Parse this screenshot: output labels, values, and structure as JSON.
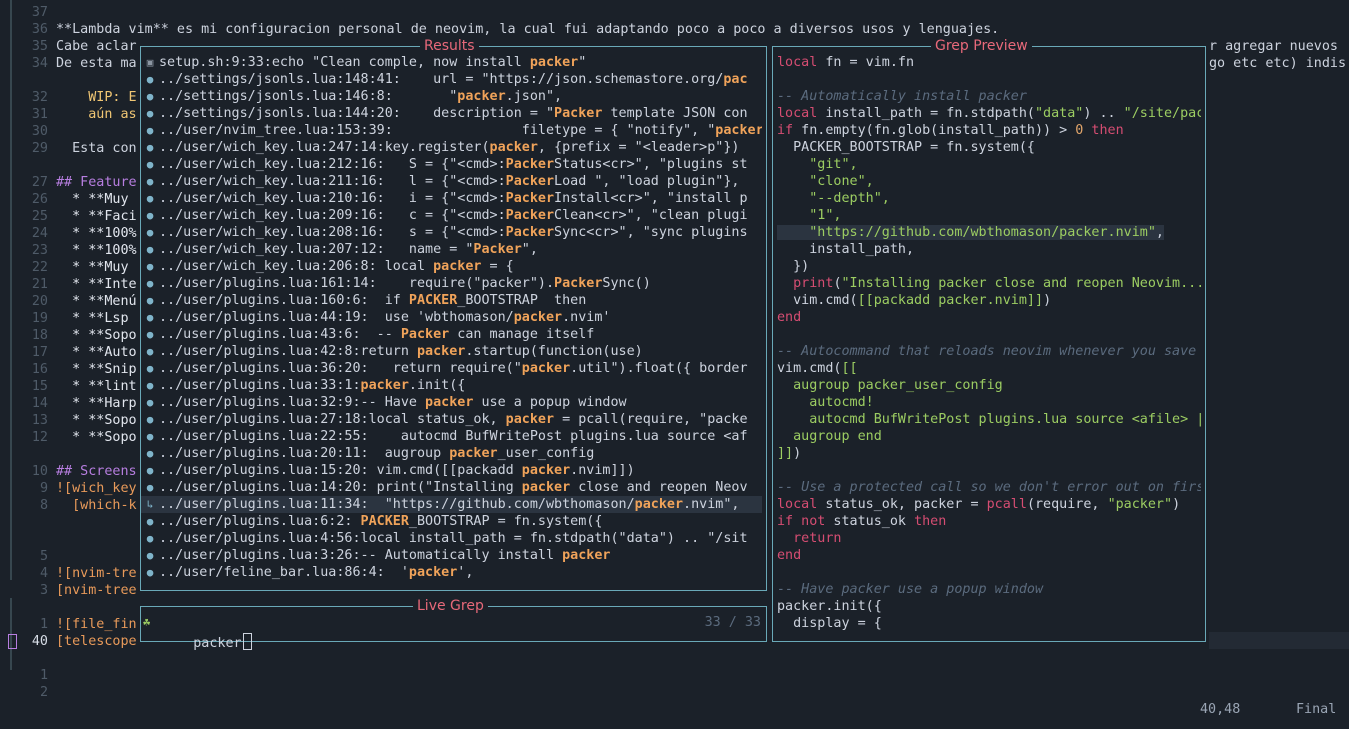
{
  "editor": {
    "line_numbers": [
      "37",
      "36",
      "35",
      "34",
      "",
      "32",
      "31",
      "30",
      "29",
      "",
      "27",
      "26",
      "25",
      "24",
      "23",
      "22",
      "21",
      "20",
      "19",
      "18",
      "17",
      "16",
      "15",
      "14",
      "13",
      "12",
      "",
      "10",
      "9",
      "8",
      "",
      "",
      "5",
      "4",
      "3",
      "",
      "1",
      "40",
      "",
      "1",
      "2"
    ],
    "text_lines": [
      "",
      "**Lambda vim** es mi configuracion personal de neovim, la cual fui adaptando poco a poco a diversos usos y lenguajes.",
      "Cabe aclar",
      "De esta ma",
      "",
      "    WIP: E",
      "    aún as",
      "",
      "  Esta con",
      "",
      "## Feature",
      "  * **Muy",
      "  * **Faci",
      "  * **100%",
      "  * **100%",
      "  * **Muy",
      "  * **Inte",
      "  * **Menú",
      "  * **Lsp",
      "  * **Sopo",
      "  * **Auto",
      "  * **Snip",
      "  * **lint",
      "  * **Harp",
      "  * **Sopo",
      "  * **Sopo",
      "",
      "## Screens",
      "![wich_key",
      "  [which-k",
      "",
      "",
      "",
      "![nvim-tre",
      "[nvim-tree",
      "",
      "![file_fin",
      "[telescope",
      "",
      "",
      ""
    ],
    "right_overflow_1": "r agregar nuevos",
    "right_overflow_2": "go etc etc) indis"
  },
  "results": {
    "title": "Results",
    "rows": [
      {
        "icon": "▣",
        "pre": "setup.sh:9:33:echo \"Clean comple, now install ",
        "hl": "packer",
        "post": "\""
      },
      {
        "icon": "●",
        "pre": "../settings/jsonls.lua:148:41:    url = \"https://json.schemastore.org/",
        "hl": "pac",
        "post": ""
      },
      {
        "icon": "●",
        "pre": "../settings/jsonls.lua:146:8:       \"",
        "hl": "packer",
        "post": ".json\","
      },
      {
        "icon": "●",
        "pre": "../settings/jsonls.lua:144:20:    description = \"",
        "hl": "Packer",
        "post": " template JSON con"
      },
      {
        "icon": "●",
        "pre": "../user/nvim_tree.lua:153:39:                filetype = { \"notify\", \"",
        "hl": "packer",
        "post": ""
      },
      {
        "icon": "●",
        "pre": "../user/wich_key.lua:247:14:key.register(",
        "hl": "packer",
        "post": ", {prefix = \"<leader>p\"})"
      },
      {
        "icon": "●",
        "pre": "../user/wich_key.lua:212:16:   S = {\"<cmd>:",
        "hl": "Packer",
        "post": "Status<cr>\", \"plugins st"
      },
      {
        "icon": "●",
        "pre": "../user/wich_key.lua:211:16:   l = {\"<cmd>:",
        "hl": "Packer",
        "post": "Load \", \"load plugin\"},"
      },
      {
        "icon": "●",
        "pre": "../user/wich_key.lua:210:16:   i = {\"<cmd>:",
        "hl": "Packer",
        "post": "Install<cr>\", \"install p"
      },
      {
        "icon": "●",
        "pre": "../user/wich_key.lua:209:16:   c = {\"<cmd>:",
        "hl": "Packer",
        "post": "Clean<cr>\", \"clean plugi"
      },
      {
        "icon": "●",
        "pre": "../user/wich_key.lua:208:16:   s = {\"<cmd>:",
        "hl": "Packer",
        "post": "Sync<cr>\", \"sync plugins"
      },
      {
        "icon": "●",
        "pre": "../user/wich_key.lua:207:12:   name = \"",
        "hl": "Packer",
        "post": "\","
      },
      {
        "icon": "●",
        "pre": "../user/wich_key.lua:206:8: local ",
        "hl": "packer",
        "post": " = {"
      },
      {
        "icon": "●",
        "pre": "../user/plugins.lua:161:14:    require(\"packer\").",
        "hl": "Packer",
        "post": "Sync()"
      },
      {
        "icon": "●",
        "pre": "../user/plugins.lua:160:6:  if ",
        "hl": "PACKER",
        "post": "_BOOTSTRAP  then"
      },
      {
        "icon": "●",
        "pre": "../user/plugins.lua:44:19:  use 'wbthomason/",
        "hl": "packer",
        "post": ".nvim'"
      },
      {
        "icon": "●",
        "pre": "../user/plugins.lua:43:6:  -- ",
        "hl": "Packer",
        "post": " can manage itself"
      },
      {
        "icon": "●",
        "pre": "../user/plugins.lua:42:8:return ",
        "hl": "packer",
        "post": ".startup(function(use)"
      },
      {
        "icon": "●",
        "pre": "../user/plugins.lua:36:20:   return require(\"",
        "hl": "packer",
        "post": ".util\").float({ border"
      },
      {
        "icon": "●",
        "pre": "../user/plugins.lua:33:1:",
        "hl": "packer",
        "post": ".init({"
      },
      {
        "icon": "●",
        "pre": "../user/plugins.lua:32:9:-- Have ",
        "hl": "packer",
        "post": " use a popup window"
      },
      {
        "icon": "●",
        "pre": "../user/plugins.lua:27:18:local status_ok, ",
        "hl": "packer",
        "post": " = pcall(require, \"packe"
      },
      {
        "icon": "●",
        "pre": "../user/plugins.lua:22:55:    autocmd BufWritePost plugins.lua source <af"
      },
      {
        "icon": "●",
        "pre": "../user/plugins.lua:20:11:  augroup ",
        "hl": "packer",
        "post": "_user_config"
      },
      {
        "icon": "●",
        "pre": "../user/plugins.lua:15:20: vim.cmd([[packadd ",
        "hl": "packer",
        "post": ".nvim]])"
      },
      {
        "icon": "●",
        "pre": "../user/plugins.lua:14:20: print(\"Installing ",
        "hl": "packer",
        "post": " close and reopen Neov"
      },
      {
        "icon": "●",
        "pre": "../user/plugins.lua:11:34:  \"https://github.com/wbthomason/",
        "hl": "packer",
        "post": ".nvim\","
      },
      {
        "icon": "●",
        "pre": "../user/plugins.lua:6:2: ",
        "hl": "PACKER",
        "post": "_BOOTSTRAP = fn.system({"
      },
      {
        "icon": "●",
        "pre": "../user/plugins.lua:4:56:local install_path = fn.stdpath(\"data\") .. \"/sit"
      },
      {
        "icon": "●",
        "pre": "../user/plugins.lua:3:26:-- Automatically install ",
        "hl": "packer",
        "post": ""
      },
      {
        "icon": "●",
        "pre": "../user/feline_bar.lua:86:4:  '",
        "hl": "packer",
        "post": "',"
      }
    ],
    "selected_index": 26,
    "selected_marker": "↳"
  },
  "grep": {
    "title": "Live Grep",
    "prompt_icon": "☘",
    "query": "packer",
    "count": "33 / 33"
  },
  "preview": {
    "title": "Grep Preview",
    "lines": [
      [
        {
          "c": "kw",
          "t": "local"
        },
        {
          "c": "fn",
          "t": " fn = vim.fn"
        }
      ],
      [],
      [
        {
          "c": "cm",
          "t": "-- Automatically install packer"
        }
      ],
      [
        {
          "c": "kw",
          "t": "local"
        },
        {
          "c": "fn",
          "t": " install_path = fn.stdpath("
        },
        {
          "c": "st",
          "t": "\"data\""
        },
        {
          "c": "fn",
          "t": ") .. "
        },
        {
          "c": "st",
          "t": "\"/site/pac"
        }
      ],
      [
        {
          "c": "kw",
          "t": "if"
        },
        {
          "c": "fn",
          "t": " fn.empty(fn.glob(install_path)) > "
        },
        {
          "c": "num",
          "t": "0"
        },
        {
          "c": "kw",
          "t": " then"
        }
      ],
      [
        {
          "c": "fn",
          "t": "  PACKER_BOOTSTRAP = fn.system({"
        }
      ],
      [
        {
          "c": "st",
          "t": "    \"git\","
        }
      ],
      [
        {
          "c": "st",
          "t": "    \"clone\","
        }
      ],
      [
        {
          "c": "st",
          "t": "    \"--depth\","
        }
      ],
      [
        {
          "c": "st",
          "t": "    \"1\","
        }
      ],
      [
        {
          "c": "st",
          "t": "    \"https://github.com/wbthomason/packer.nvim\""
        },
        {
          "c": "fn",
          "t": ","
        }
      ],
      [
        {
          "c": "fn",
          "t": "    install_path,"
        }
      ],
      [
        {
          "c": "fn",
          "t": "  })"
        }
      ],
      [
        {
          "c": "kw",
          "t": "  print"
        },
        {
          "c": "fn",
          "t": "("
        },
        {
          "c": "st",
          "t": "\"Installing packer close and reopen Neovim..."
        }
      ],
      [
        {
          "c": "fn",
          "t": "  vim.cmd("
        },
        {
          "c": "st",
          "t": "[[packadd packer.nvim]]"
        },
        {
          "c": "fn",
          "t": ")"
        }
      ],
      [
        {
          "c": "kw",
          "t": "end"
        }
      ],
      [],
      [
        {
          "c": "cm",
          "t": "-- Autocommand that reloads neovim whenever you save"
        }
      ],
      [
        {
          "c": "fn",
          "t": "vim.cmd("
        },
        {
          "c": "st",
          "t": "[["
        }
      ],
      [
        {
          "c": "st",
          "t": "  augroup packer_user_config"
        }
      ],
      [
        {
          "c": "st",
          "t": "    autocmd!"
        }
      ],
      [
        {
          "c": "st",
          "t": "    autocmd BufWritePost plugins.lua source <afile> |"
        }
      ],
      [
        {
          "c": "st",
          "t": "  augroup end"
        }
      ],
      [
        {
          "c": "st",
          "t": "]]"
        },
        {
          "c": "fn",
          "t": ")"
        }
      ],
      [],
      [
        {
          "c": "cm",
          "t": "-- Use a protected call so we don't error out on firs"
        }
      ],
      [
        {
          "c": "kw",
          "t": "local"
        },
        {
          "c": "fn",
          "t": " status_ok, packer = "
        },
        {
          "c": "kw",
          "t": "pcall"
        },
        {
          "c": "fn",
          "t": "(require, "
        },
        {
          "c": "st",
          "t": "\"packer\""
        },
        {
          "c": "fn",
          "t": ")"
        }
      ],
      [
        {
          "c": "kw",
          "t": "if not"
        },
        {
          "c": "fn",
          "t": " status_ok "
        },
        {
          "c": "kw",
          "t": "then"
        }
      ],
      [
        {
          "c": "kw",
          "t": "  return"
        }
      ],
      [
        {
          "c": "kw",
          "t": "end"
        }
      ],
      [],
      [
        {
          "c": "cm",
          "t": "-- Have packer use a popup window"
        }
      ],
      [
        {
          "c": "fn",
          "t": "packer.init({"
        }
      ],
      [
        {
          "c": "fn",
          "t": "  display = {"
        }
      ]
    ],
    "highlight_line": 10
  },
  "status": {
    "position": "40,48",
    "scroll": "Final"
  },
  "colors": {
    "background": "#1b2129",
    "border": "#6aa9b8",
    "title": "#e8697a",
    "match": "#f0a35a"
  }
}
